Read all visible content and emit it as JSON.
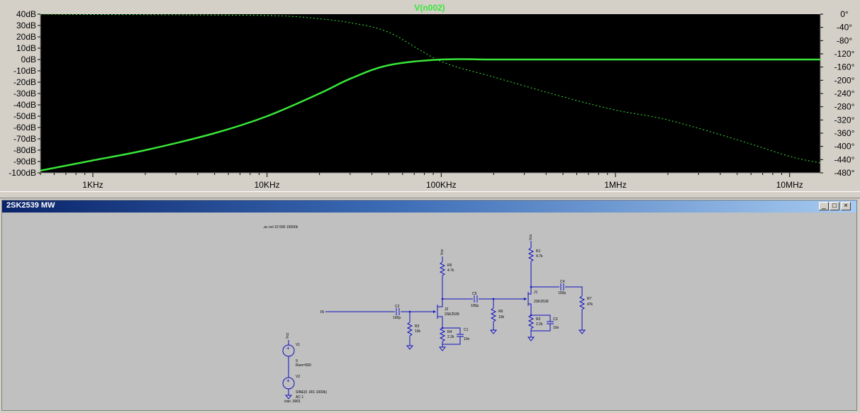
{
  "plot": {
    "trace_name": "V(n002)",
    "left_axis_ticks": [
      "40dB",
      "30dB",
      "20dB",
      "10dB",
      "0dB",
      "-10dB",
      "-20dB",
      "-30dB",
      "-40dB",
      "-50dB",
      "-60dB",
      "-70dB",
      "-80dB",
      "-90dB",
      "-100dB"
    ],
    "right_axis_ticks": [
      "0°",
      "-40°",
      "-80°",
      "-120°",
      "-160°",
      "-200°",
      "-240°",
      "-280°",
      "-320°",
      "-360°",
      "-400°",
      "-440°",
      "-480°"
    ],
    "x_axis_ticks": [
      "1KHz",
      "10KHz",
      "100KHz",
      "1MHz",
      "10MHz"
    ],
    "colors": {
      "background": "#000000",
      "trace": "#39e639",
      "grid_axis": "#808080"
    }
  },
  "chart_data": {
    "type": "line",
    "xscale": "log",
    "xlim": [
      500,
      15000000
    ],
    "ylim_left": [
      -100,
      40
    ],
    "ylim_right": [
      -480,
      0
    ],
    "series": [
      {
        "name": "V(n002)",
        "style": "solid",
        "axis": "left",
        "x": [
          500,
          1000,
          2000,
          5000,
          10000,
          20000,
          30000,
          50000,
          100000,
          200000,
          400000,
          700000,
          1000000,
          2000000,
          5000000,
          10000000,
          15000000
        ],
        "y": [
          -98,
          -89,
          -80,
          -65,
          -50,
          -30,
          -17,
          -5,
          0,
          0,
          0,
          0,
          0,
          0,
          0,
          0,
          0
        ]
      },
      {
        "name": "V(n002)",
        "style": "dashed",
        "axis": "right",
        "x": [
          500,
          1000,
          3000,
          10000,
          15000,
          20000,
          30000,
          50000,
          100000,
          200000,
          500000,
          1000000,
          2000000,
          5000000,
          10000000,
          15000000
        ],
        "y": [
          0,
          -1,
          -2,
          -4,
          -8,
          -14,
          -26,
          -55,
          -143,
          -190,
          -250,
          -290,
          -320,
          -380,
          -430,
          -450
        ]
      }
    ]
  },
  "schematic_window": {
    "title": "2SK2539 MW",
    "minimize": "_",
    "maximize": "□",
    "close": "×"
  },
  "schematic": {
    "directive_ac": ".ac oct 10 500 15000k",
    "directive_tran": ".tran .0001",
    "labels": {
      "in": "IN",
      "vcc1": "Vcc",
      "vcc2": "Vcc",
      "vcc3": "Vcc",
      "r5": "R5",
      "r5v": "4.7k",
      "r1": "R1",
      "r1v": "4.7k",
      "c2": "C2",
      "c2v": "100p",
      "r3": "R3",
      "r3v": "10k",
      "j2": "J2",
      "j2m": "2SK2539",
      "r4": "R4",
      "r4v": "2.2k",
      "c1": "C1",
      "c1v": "10n",
      "c5": "C5",
      "c5v": "100p",
      "r6": "R6",
      "r6v": "10k",
      "j1": "J1",
      "j1m": "2SK2539",
      "r2": "R2",
      "r2v": "2.2k",
      "c3": "C3",
      "c3v": "10n",
      "c4": "C4",
      "c4v": "100p",
      "r7": "R7",
      "r7v": "47k",
      "v1": "V1",
      "v1v": "9",
      "v1r": "Rser=500",
      "v2": "V2",
      "v2v": "SINE(0 .001 1000k)",
      "v2ac": "AC 1"
    }
  }
}
